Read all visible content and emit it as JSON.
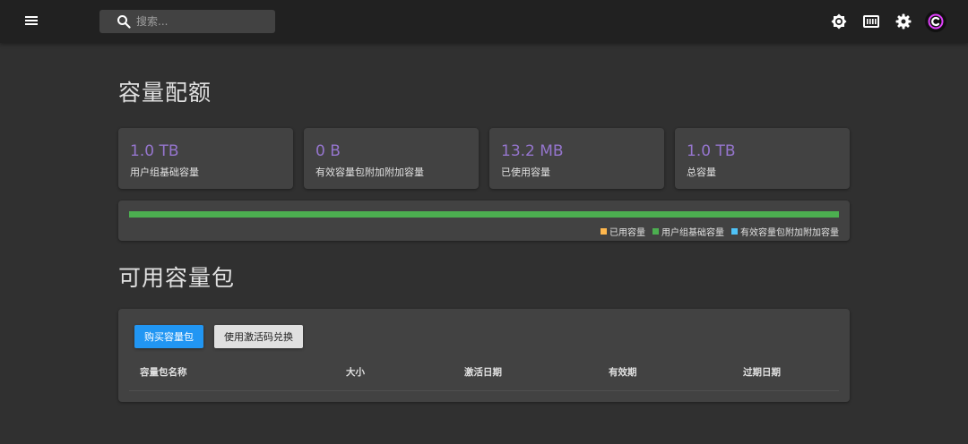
{
  "topbar": {
    "search_placeholder": "搜索...",
    "icons": [
      "menu-icon",
      "search-icon",
      "brightness-icon",
      "storage-icon",
      "gear-icon",
      "avatar-logo-icon"
    ]
  },
  "quota": {
    "title": "容量配额",
    "stats": [
      {
        "value": "1.0 TB",
        "label": "用户组基础容量"
      },
      {
        "value": "0 B",
        "label": "有效容量包附加附加容量"
      },
      {
        "value": "13.2 MB",
        "label": "已使用容量"
      },
      {
        "value": "1.0 TB",
        "label": "总容量"
      }
    ],
    "usage_bar": {
      "group_base_fraction": 1.0,
      "used_fraction": 0.0,
      "pack_fraction": 0.0
    },
    "legend": [
      {
        "label": "已用容量",
        "color": "#ffb74d"
      },
      {
        "label": "用户组基础容量",
        "color": "#4caf50"
      },
      {
        "label": "有效容量包附加附加容量",
        "color": "#4fc3f7"
      }
    ]
  },
  "packs": {
    "title": "可用容量包",
    "buy_button": "购买容量包",
    "redeem_button": "使用激活码兑换",
    "columns": [
      "容量包名称",
      "大小",
      "激活日期",
      "有效期",
      "过期日期"
    ]
  },
  "colors": {
    "accent": "#9575cd",
    "primary_button": "#2196f3",
    "background": "#303030",
    "card": "#424242"
  }
}
